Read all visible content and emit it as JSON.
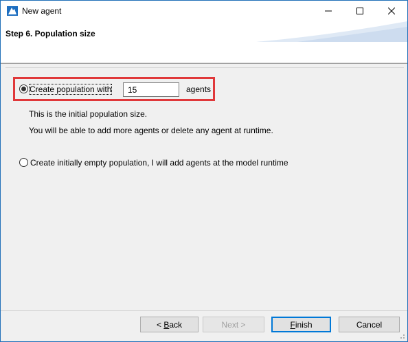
{
  "window": {
    "title": "New agent",
    "controls": [
      "minimize-icon",
      "maximize-icon",
      "close-icon"
    ]
  },
  "header": {
    "step_title": "Step 6. Population size"
  },
  "options": {
    "create_population": {
      "label": "Create population with",
      "value": "15",
      "suffix": "agents",
      "selected": true
    },
    "info_line1": "This is the initial population size.",
    "info_line2": "You will be able to add more agents or delete any agent at runtime.",
    "empty_population": {
      "label": "Create initially empty population, I will add agents at the model runtime",
      "selected": false
    }
  },
  "buttons": {
    "back": {
      "prefix": "< ",
      "mnemonic": "B",
      "rest": "ack"
    },
    "next": {
      "label": "Next >"
    },
    "finish": {
      "mnemonic": "F",
      "rest": "inish"
    },
    "cancel": {
      "label": "Cancel"
    }
  },
  "colors": {
    "highlight": "#e0383a",
    "accent": "#0078d7",
    "window_border": "#1f6fb8"
  }
}
